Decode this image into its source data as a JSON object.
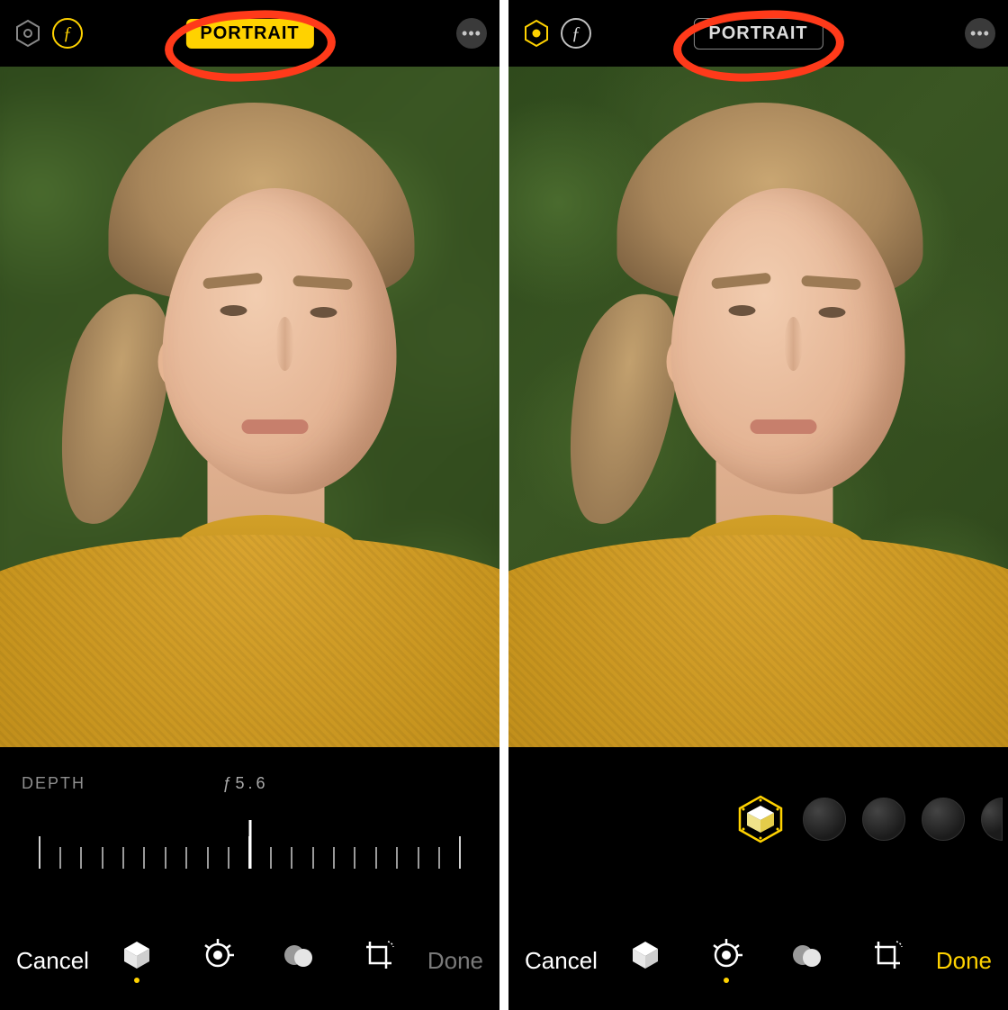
{
  "left_panel": {
    "header": {
      "portrait_label": "PORTRAIT",
      "portrait_active": true,
      "lighting_icon_state": "inactive-gray",
      "fstop_icon_state": "active-yellow"
    },
    "middle": {
      "title_label": "DEPTH",
      "value_label": "ƒ5.6"
    },
    "toolbar": {
      "cancel_label": "Cancel",
      "done_label": "Done",
      "done_enabled": false,
      "active_tool_index": 0
    }
  },
  "right_panel": {
    "header": {
      "portrait_label": "PORTRAIT",
      "portrait_active": false,
      "lighting_icon_state": "active-yellow",
      "fstop_icon_state": "inactive-white"
    },
    "lighting": {
      "selected_index": 0,
      "options": [
        {
          "name": "natural-light",
          "selected": true
        },
        {
          "name": "studio-light",
          "selected": false
        },
        {
          "name": "contour-light",
          "selected": false
        },
        {
          "name": "stage-light",
          "selected": false
        },
        {
          "name": "stage-light-mono",
          "selected": false
        }
      ]
    },
    "toolbar": {
      "cancel_label": "Cancel",
      "done_label": "Done",
      "done_enabled": true,
      "active_tool_index": 1
    }
  },
  "icons": {
    "hex": "lighting-hexagon-icon",
    "f": "aperture-fstop-icon",
    "more": "more-options-icon",
    "cube": "portrait-cube-icon",
    "adjust": "adjust-dial-icon",
    "filters": "filters-circles-icon",
    "crop": "crop-rotate-icon"
  },
  "annotation": {
    "shape": "ellipse",
    "color": "#ff3a1a",
    "target": "portrait-badge"
  },
  "colors": {
    "accent_yellow": "#ffd200",
    "annotation_red": "#ff3a1a",
    "sweater": "#c8951f"
  }
}
